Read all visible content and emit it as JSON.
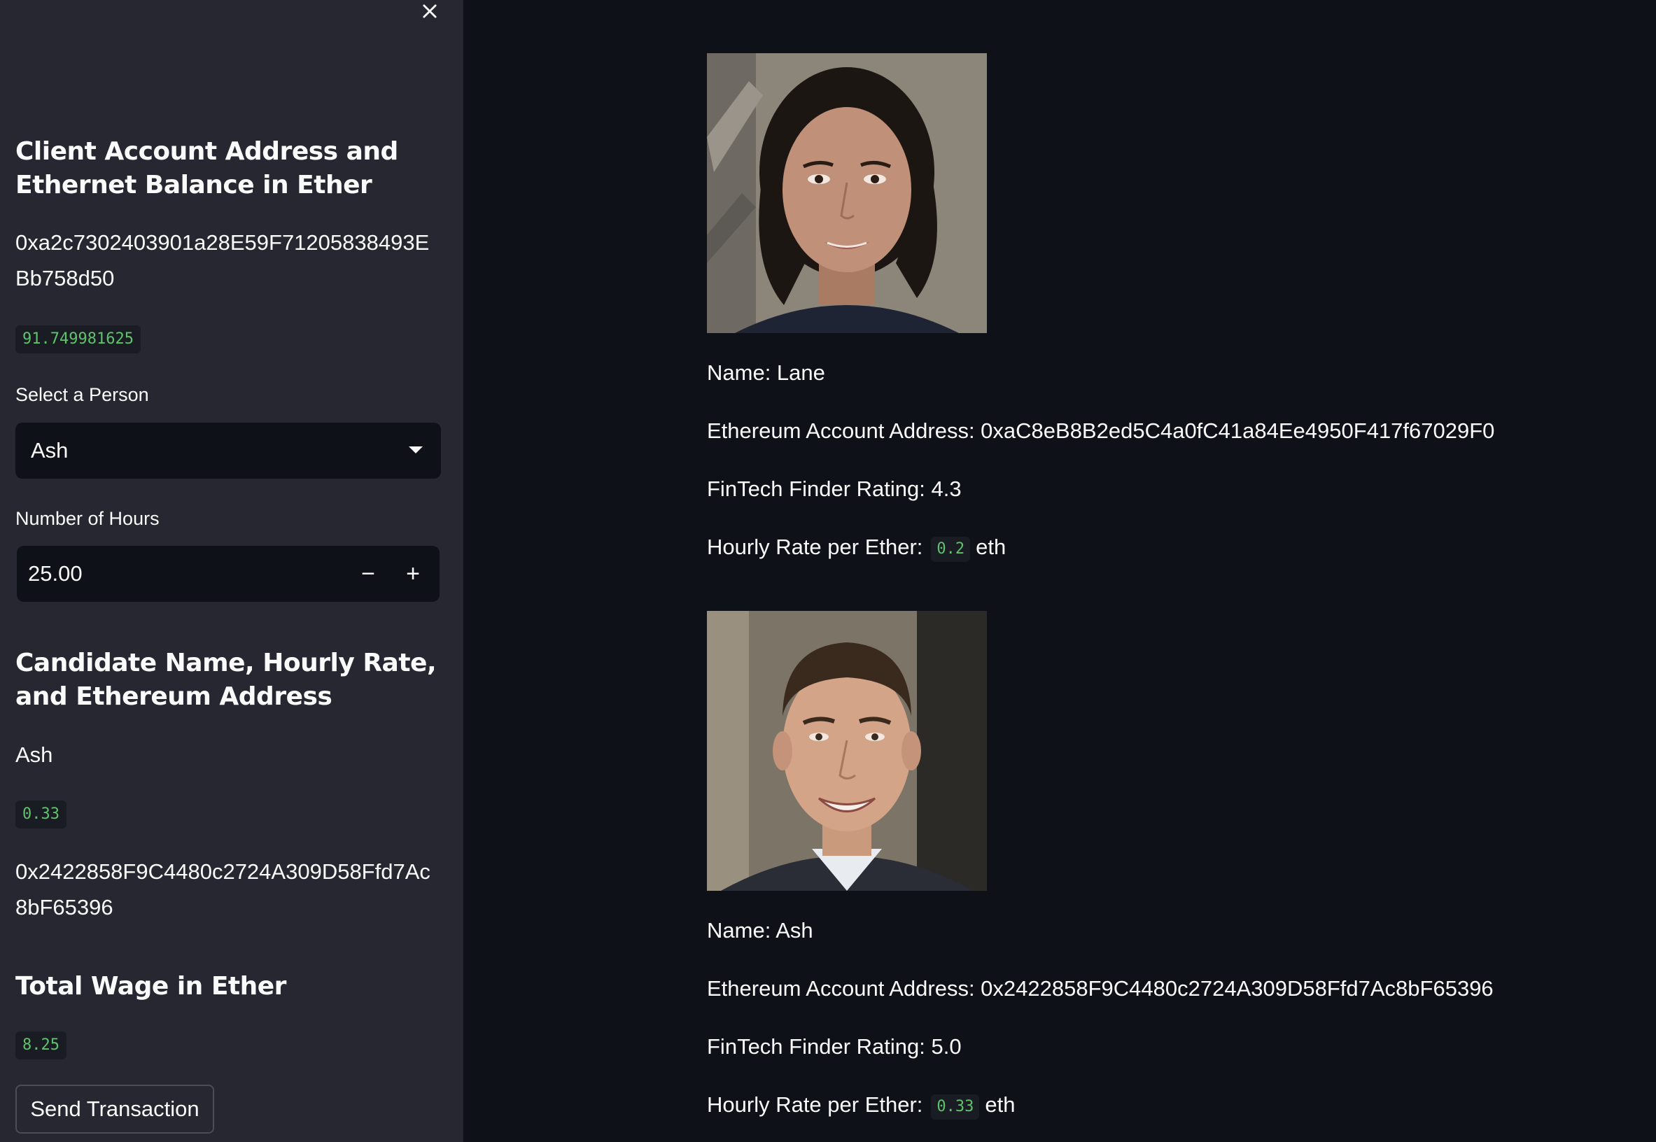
{
  "sidebar": {
    "close_icon": "close-icon",
    "section1": {
      "heading": "Client Account Address and Ethernet Balance in Ether",
      "address": "0xa2c7302403901a28E59F71205838493EBb758d50",
      "balance": "91.749981625"
    },
    "select_person": {
      "label": "Select a Person",
      "value": "Ash"
    },
    "hours": {
      "label": "Number of Hours",
      "value": "25.00",
      "minus_label": "−",
      "plus_label": "+"
    },
    "section2": {
      "heading": "Candidate Name, Hourly Rate, and Ethereum Address",
      "name": "Ash",
      "rate": "0.33",
      "address": "0x2422858F9C4480c2724A309D58Ffd7Ac8bF65396"
    },
    "section3": {
      "heading": "Total Wage in Ether",
      "wage": "8.25"
    },
    "send_button": "Send Transaction"
  },
  "candidates": [
    {
      "name_line": "Name: Lane",
      "address_line": "Ethereum Account Address: 0xaC8eB8B2ed5C4a0fC41a84Ee4950F417f67029F0",
      "rating_line": "FinTech Finder Rating: 4.3",
      "rate_label": "Hourly Rate per Ether:",
      "rate_value": "0.2",
      "rate_unit": "eth"
    },
    {
      "name_line": "Name: Ash",
      "address_line": "Ethereum Account Address: 0x2422858F9C4480c2724A309D58Ffd7Ac8bF65396",
      "rating_line": "FinTech Finder Rating: 5.0",
      "rate_label": "Hourly Rate per Ether:",
      "rate_value": "0.33",
      "rate_unit": "eth"
    }
  ],
  "colors": {
    "sidebar_bg": "#262730",
    "main_bg": "#0e1117",
    "code_green": "#5fc36b"
  }
}
